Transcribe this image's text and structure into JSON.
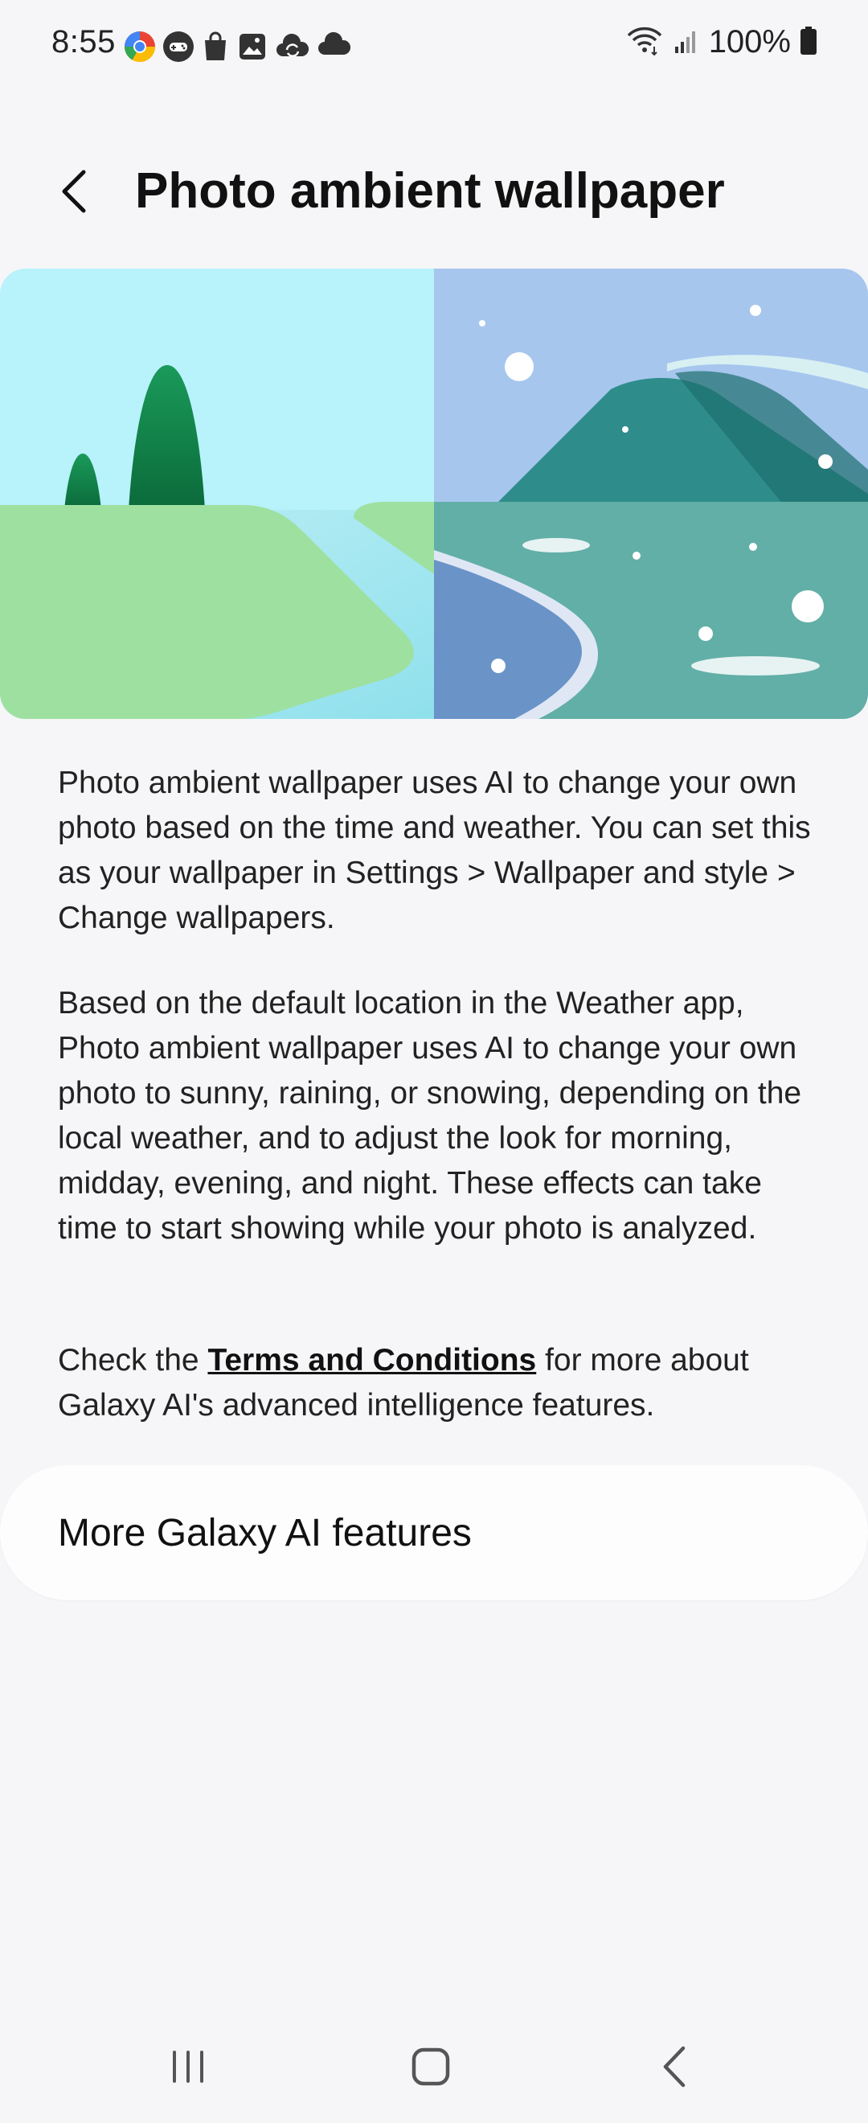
{
  "status_bar": {
    "time": "8:55",
    "battery": "100%",
    "left_icons": [
      "chrome-icon",
      "game-controller-icon",
      "shopping-bag-icon",
      "gallery-icon",
      "cloud-sync-icon",
      "cloud-icon"
    ],
    "right_icons": [
      "wifi-icon",
      "signal-icon",
      "battery-icon"
    ]
  },
  "header": {
    "title": "Photo ambient wallpaper",
    "back_icon": "chevron-left-icon"
  },
  "content": {
    "paragraph1": "Photo ambient wallpaper uses AI to change your own photo based on the time and weather. You can set this as your wallpaper in Settings > Wallpaper and style > Change wallpapers.",
    "paragraph2": "Based on the default location in the Weather app, Photo ambient wallpaper uses AI to change your own photo to sunny, raining, or snowing, depending on the local weather, and to adjust the look for morning, midday, evening, and night. These effects can take time to start showing while your photo is analyzed.",
    "paragraph3_prefix": "Check the ",
    "terms_link": "Terms and Conditions",
    "paragraph3_suffix": " for more about Galaxy AI's advanced intelligence features."
  },
  "more_card": {
    "label": "More Galaxy AI features"
  },
  "nav_bar": {
    "items": [
      "recent-apps-icon",
      "home-icon",
      "back-icon"
    ]
  },
  "colors": {
    "background": "#f6f6f8",
    "card": "#fdfdfe",
    "text": "#111111"
  }
}
